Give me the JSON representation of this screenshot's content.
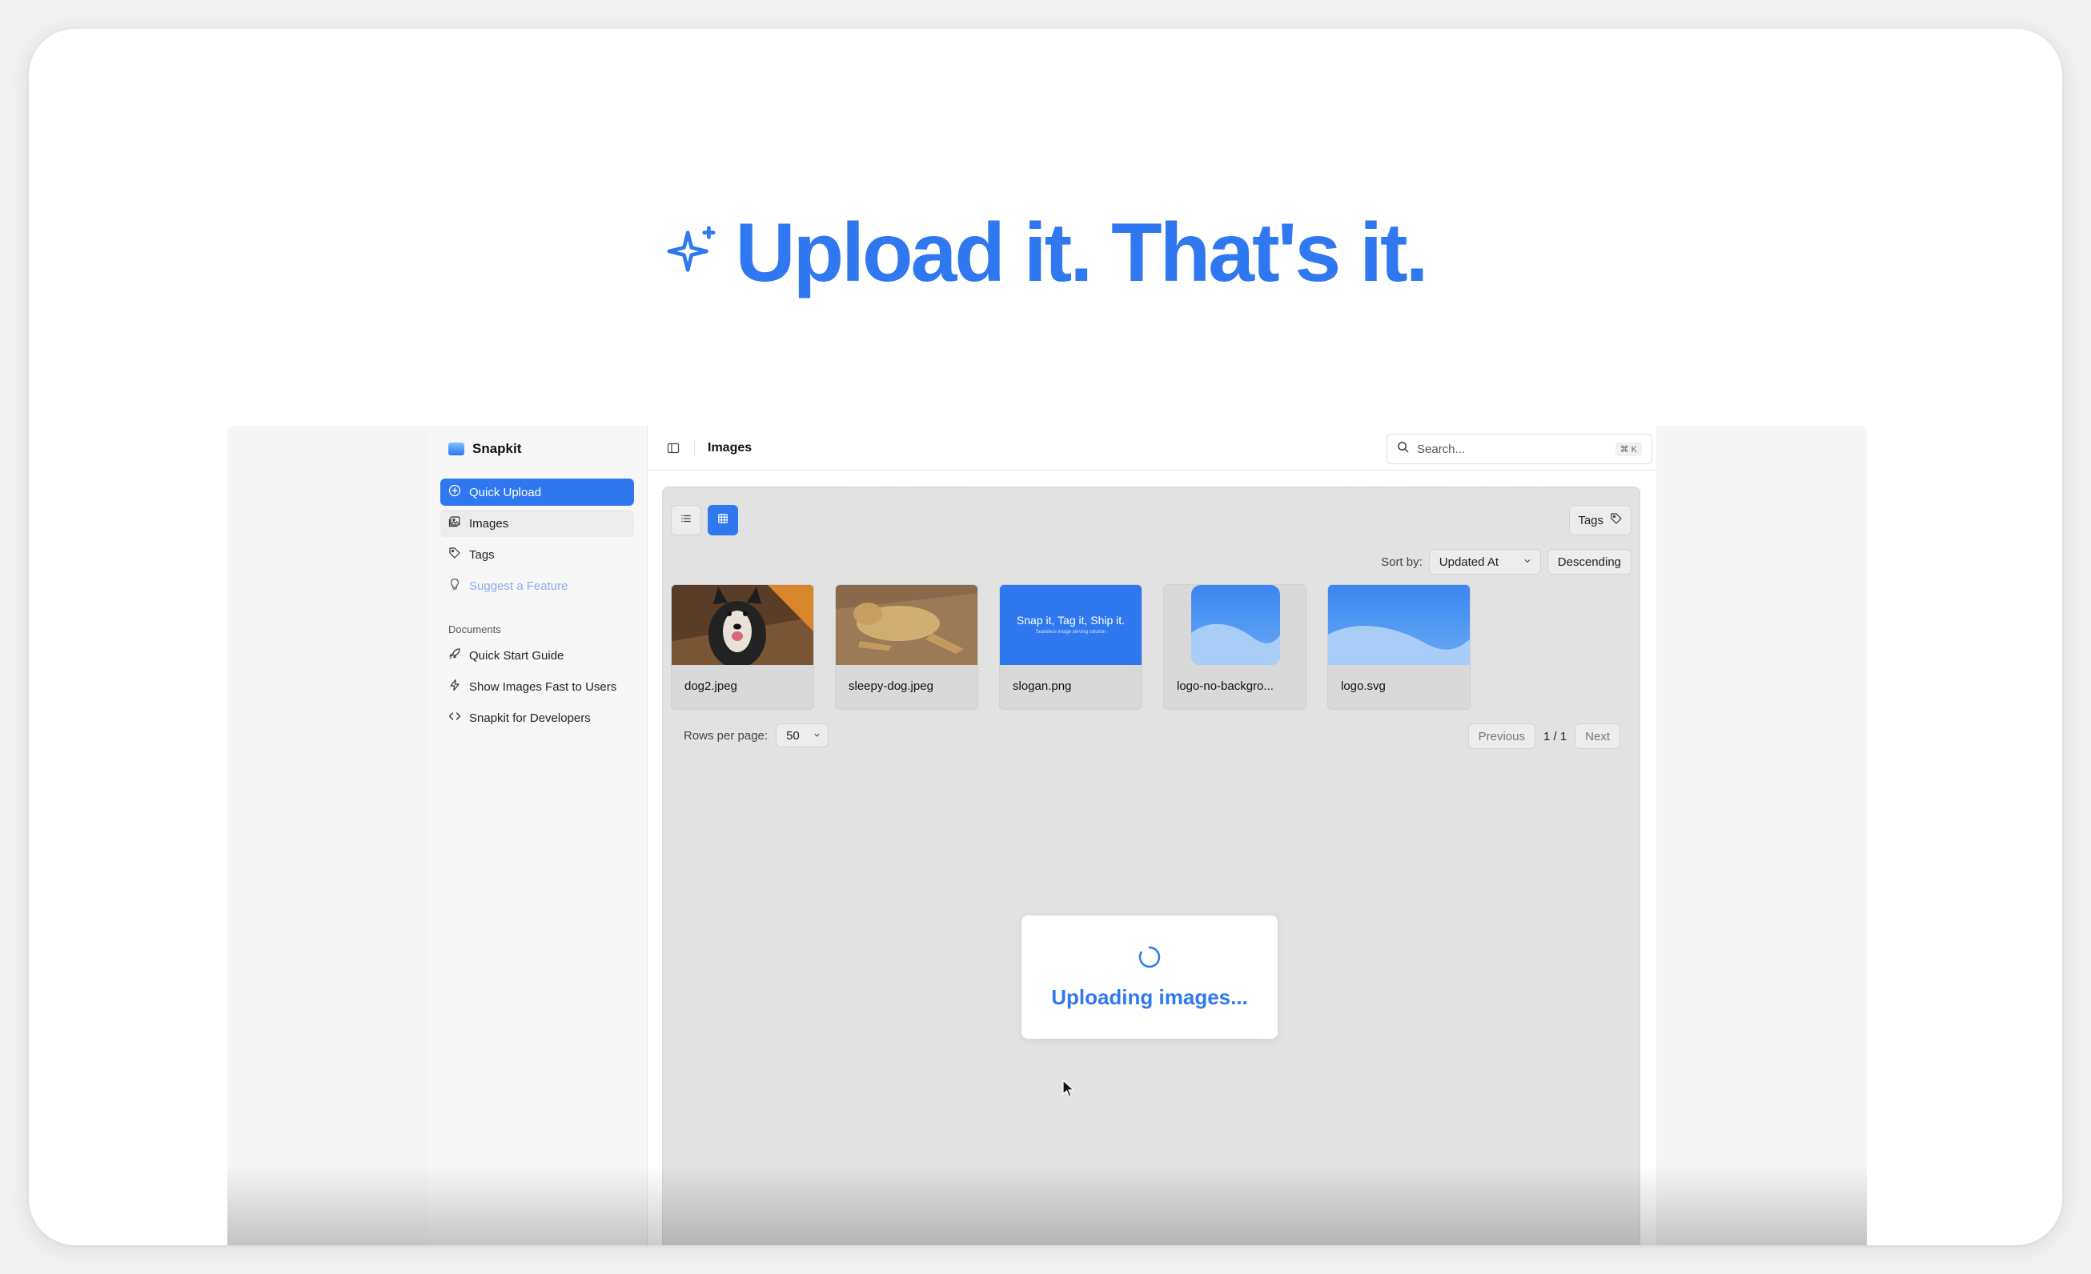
{
  "hero": {
    "title": "Upload it. That's it.",
    "icon": "sparkle-icon"
  },
  "colors": {
    "accent": "#2f78f0",
    "content_bg": "#e2e2e2",
    "sidebar_bg": "#f7f7f7"
  },
  "sidebar": {
    "brand": "Snapkit",
    "quick_upload": "Quick Upload",
    "items": [
      {
        "label": "Images",
        "icon": "images-icon"
      },
      {
        "label": "Tags",
        "icon": "tag-icon"
      },
      {
        "label": "Suggest a Feature",
        "icon": "lightbulb-icon"
      }
    ],
    "documents_label": "Documents",
    "documents": [
      {
        "label": "Quick Start Guide",
        "icon": "rocket-icon"
      },
      {
        "label": "Show Images Fast to Users",
        "icon": "bolt-icon"
      },
      {
        "label": "Snapkit for Developers",
        "icon": "code-icon"
      }
    ]
  },
  "header": {
    "title": "Images",
    "search_placeholder": "Search...",
    "search_shortcut": "⌘ K"
  },
  "toolbar": {
    "tags_label": "Tags",
    "sort_label": "Sort by:",
    "sort_value": "Updated At",
    "sort_order": "Descending"
  },
  "images": [
    {
      "name": "dog2.jpeg"
    },
    {
      "name": "sleepy-dog.jpeg"
    },
    {
      "name": "slogan.png",
      "slogan_title": "Snap it, Tag it, Ship it.",
      "slogan_sub": "Seamless image serving solution"
    },
    {
      "name": "logo-no-backgro..."
    },
    {
      "name": "logo.svg"
    }
  ],
  "pagination": {
    "rows_label": "Rows per page:",
    "rows_value": "50",
    "previous": "Previous",
    "page_info": "1 / 1",
    "next": "Next"
  },
  "upload": {
    "status": "Uploading images..."
  }
}
